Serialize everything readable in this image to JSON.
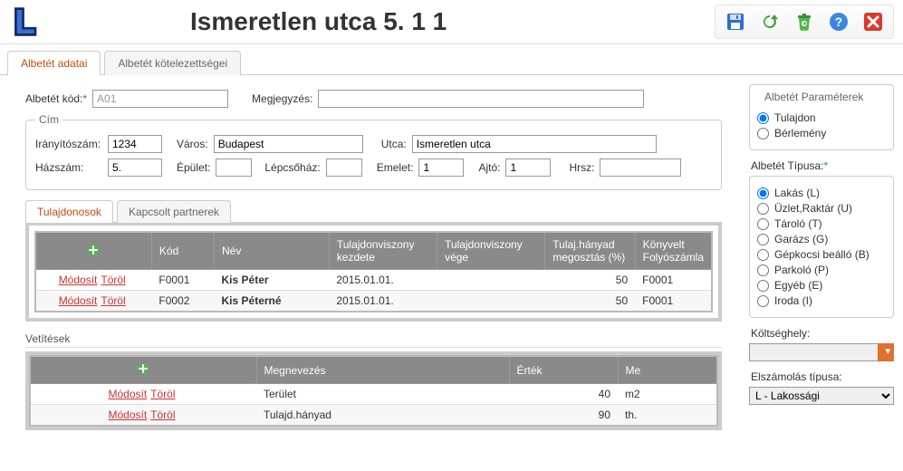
{
  "header": {
    "title": "Ismeretlen utca 5. 1 1"
  },
  "tabs": {
    "data": "Albetét adatai",
    "obligations": "Albetét kötelezettségei"
  },
  "labels": {
    "code": "Albetét kód:",
    "note": "Megjegyzés:",
    "address_legend": "Cím",
    "zip": "Irányítószám:",
    "city": "Város:",
    "street": "Utca:",
    "house": "Házszám:",
    "building": "Épület:",
    "stair": "Lépcsőház:",
    "floor": "Emelet:",
    "door": "Ajtó:",
    "hrsz": "Hrsz:"
  },
  "values": {
    "code": "A01",
    "note": "",
    "zip": "1234",
    "city": "Budapest",
    "street": "Ismeretlen utca",
    "house": "5.",
    "building": "",
    "stair": "",
    "floor": "1",
    "door": "1",
    "hrsz": ""
  },
  "inner_tabs": {
    "owners": "Tulajdonosok",
    "partners": "Kapcsolt partnerek"
  },
  "actions": {
    "edit": "Módosít",
    "delete": "Töröl"
  },
  "owners": {
    "headers": {
      "code": "Kód",
      "name": "Név",
      "rel_start": "Tulajdonviszony kezdete",
      "rel_end": "Tulajdonviszony vége",
      "share": "Tulaj.hányad megosztás (%)",
      "account": "Könyvelt Folyószámla"
    },
    "rows": [
      {
        "code": "F0001",
        "name": "Kis Péter",
        "rel_start": "2015.01.01.",
        "rel_end": "",
        "share": "50",
        "account": "F0001"
      },
      {
        "code": "F0002",
        "name": "Kis Péterné",
        "rel_start": "2015.01.01.",
        "rel_end": "",
        "share": "50",
        "account": "F0001"
      }
    ]
  },
  "projections": {
    "title": "Vetítések",
    "headers": {
      "name": "Megnevezés",
      "value": "Érték",
      "unit": "Me"
    },
    "rows": [
      {
        "name": "Terület",
        "value": "40",
        "unit": "m2"
      },
      {
        "name": "Tulajd.hányad",
        "value": "90",
        "unit": "th."
      }
    ]
  },
  "sidebar": {
    "params_legend": "Albetét Paraméterek",
    "ownership": {
      "own": "Tulajdon",
      "rent": "Bérlemény"
    },
    "type_label": "Albetét Típusa:",
    "types": [
      "Lakás (L)",
      "Üzlet,Raktár (U)",
      "Tároló (T)",
      "Garázs (G)",
      "Gépkocsi beálló (B)",
      "Parkoló (P)",
      "Egyéb (E)",
      "Iroda (I)"
    ],
    "costcenter_label": "Költséghely:",
    "costcenter_value": "",
    "settlement_label": "Elszámolás típusa:",
    "settlement_value": "L - Lakossági"
  }
}
